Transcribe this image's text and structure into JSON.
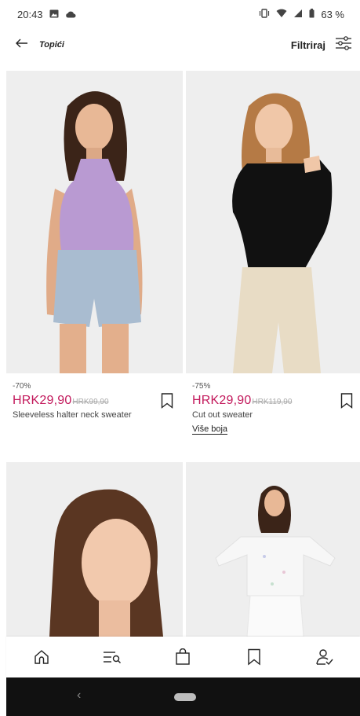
{
  "status_bar": {
    "time": "20:43",
    "battery": "63 %",
    "icons": [
      "image-icon",
      "cloud-icon",
      "vibrate-icon",
      "wifi-icon",
      "signal-icon",
      "battery-icon"
    ]
  },
  "header": {
    "back_icon": "arrow-left-icon",
    "title": "Topići",
    "filter_label": "Filtriraj",
    "filter_icon": "sliders-icon"
  },
  "products": [
    {
      "discount": "-70%",
      "price": "HRK29,90",
      "old_price": "HRK99,90",
      "name": "Sleeveless halter neck sweater",
      "more_colors": "",
      "image": "model-lilac-halter-top-denim-shorts"
    },
    {
      "discount": "-75%",
      "price": "HRK29,90",
      "old_price": "HRK119,90",
      "name": "Cut out sweater",
      "more_colors": "Više boja",
      "image": "model-black-cutout-top-cream-jeans"
    },
    {
      "image": "model-portrait-brown-hair"
    },
    {
      "image": "model-white-floral-blouse"
    }
  ],
  "bottom_nav": {
    "items": [
      "home-icon",
      "search-menu-icon",
      "shopping-bag-icon",
      "bookmark-icon",
      "account-icon"
    ]
  },
  "system_nav": {
    "back": "‹"
  },
  "colors": {
    "price": "#c2185b",
    "image_bg": "#f1f1f1",
    "system_bar": "#111111"
  }
}
